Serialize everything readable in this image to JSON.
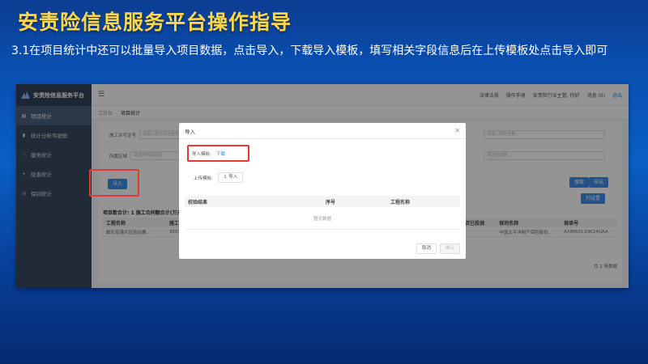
{
  "slide": {
    "title": "安责险信息服务平台操作指导",
    "description": "3.1在项目统计中还可以批量导入项目数据，点击导入，下载导入模板，填写相关字段信息后在上传模板处点击导入即可"
  },
  "app": {
    "brand": "安责险信息服务平台",
    "sidebar": [
      {
        "label": "项目统计",
        "icon": "doc-icon",
        "active": true
      },
      {
        "label": "统计分析驾驶舱",
        "icon": "bar-chart-icon",
        "active": false
      },
      {
        "label": "服务统计",
        "icon": "shield-icon",
        "active": false
      },
      {
        "label": "隐患统计",
        "icon": "plus-icon",
        "active": false
      },
      {
        "label": "保间统计",
        "icon": "clock-icon",
        "active": false
      }
    ],
    "topbar": {
      "links": [
        "法律法规",
        "操作手册",
        "安责险行业主管, 你好",
        "消息 (0)"
      ],
      "logout": "退出"
    },
    "tabs": [
      "工作台",
      "项目统计"
    ],
    "filters": {
      "construction_permit_label": "施工许可证号",
      "construction_permit_placeholder": "请输入施工许可证号",
      "area_label": "所属区域",
      "area_placeholder": "请选择所属区域",
      "right_field_placeholder": "请输入项目名称",
      "date_placeholder": "请选择日期"
    },
    "buttons": {
      "import": "导入",
      "search": "搜索",
      "export": "导出",
      "column_setting": "列设置"
    },
    "stat_text": "项目数合计: 1  施工合同额合计(万元)",
    "table": {
      "headers": [
        "工程名称",
        "施工许",
        "",
        "",
        "",
        "",
        "是否已投保",
        "保司名称",
        "保单号"
      ],
      "rows": [
        [
          "邮轮母港片区航站楼...",
          "3502",
          "",
          "",
          "",
          "",
          "是",
          "中国太平洋财产保险股份...",
          "AXIM5011NK24QAA"
        ]
      ]
    },
    "pager": "共 1 条数据"
  },
  "modal": {
    "title": "导入",
    "template_label": "导入模板:",
    "download_link": "下载",
    "upload_label": "上传模板:",
    "upload_button": "导入",
    "table_headers": [
      "校验结果",
      "序号",
      "工程名称"
    ],
    "empty_text": "暂无数据",
    "cancel": "取消",
    "confirm": "确认"
  },
  "colors": {
    "title": "#ffd84a",
    "highlight": "#e53935",
    "primary": "#3d8ef0",
    "sidebar": "#3a4a60"
  }
}
